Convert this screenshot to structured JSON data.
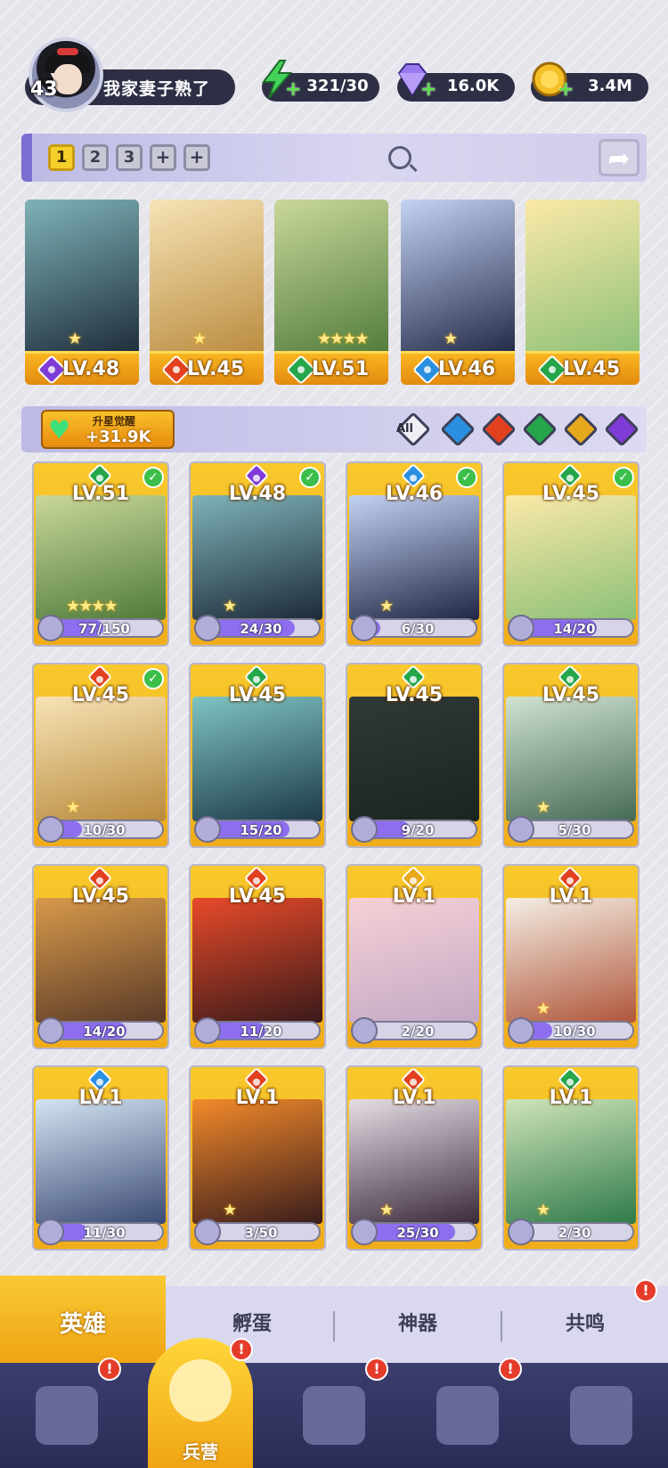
{
  "player": {
    "level": "43",
    "name": "我家妻子熟了"
  },
  "resources": [
    {
      "name": "energy",
      "icon": "lightning-icon",
      "value": "321/30",
      "color": "#43d35a"
    },
    {
      "name": "gems",
      "icon": "diamond-icon",
      "value": "16.0K",
      "color": "#9a7af0"
    },
    {
      "name": "gold",
      "icon": "coin-icon",
      "value": "3.4M",
      "color": "#f5c026"
    }
  ],
  "team": {
    "tabs": [
      "1",
      "2",
      "3",
      "+",
      "+"
    ],
    "active_tab": "1",
    "slots": [
      {
        "level": "LV.48",
        "element": "purple",
        "stars": "★"
      },
      {
        "level": "LV.45",
        "element": "fire",
        "stars": "★"
      },
      {
        "level": "LV.51",
        "element": "nature",
        "stars": "★★★★"
      },
      {
        "level": "LV.46",
        "element": "water",
        "stars": "★"
      },
      {
        "level": "LV.45",
        "element": "nature",
        "stars": ""
      }
    ]
  },
  "filter": {
    "awaken_label": "升星觉醒",
    "awaken_value": "+31.9K",
    "all_label": "All",
    "elements": [
      "water",
      "fire",
      "nature",
      "light",
      "purple"
    ]
  },
  "heroes": [
    {
      "level": "LV.51",
      "element": "nature",
      "checked": true,
      "shards": "77/150",
      "fill": 0.51,
      "stars": "★★★★",
      "art": [
        "#c9d89a",
        "#4f7a3a"
      ]
    },
    {
      "level": "LV.48",
      "element": "purple",
      "checked": true,
      "shards": "24/30",
      "fill": 0.8,
      "stars": "★",
      "art": [
        "#7fb3b8",
        "#1d2a38"
      ]
    },
    {
      "level": "LV.46",
      "element": "water",
      "checked": true,
      "shards": "6/30",
      "fill": 0.2,
      "stars": "★",
      "art": [
        "#c3d3f3",
        "#202645"
      ]
    },
    {
      "level": "LV.45",
      "element": "nature",
      "checked": true,
      "shards": "14/20",
      "fill": 0.7,
      "stars": "",
      "art": [
        "#fbe9a8",
        "#8cc077"
      ]
    },
    {
      "level": "LV.45",
      "element": "fire",
      "checked": true,
      "shards": "10/30",
      "fill": 0.33,
      "stars": "★",
      "art": [
        "#f6e3b6",
        "#b98a3d"
      ]
    },
    {
      "level": "LV.45",
      "element": "nature",
      "checked": false,
      "shards": "15/20",
      "fill": 0.75,
      "stars": "",
      "art": [
        "#7fc4c2",
        "#1d3a48"
      ]
    },
    {
      "level": "LV.45",
      "element": "nature",
      "checked": false,
      "shards": "9/20",
      "fill": 0.45,
      "stars": "",
      "art": [
        "#2f3a38",
        "#1a2420"
      ]
    },
    {
      "level": "LV.45",
      "element": "nature",
      "checked": false,
      "shards": "5/30",
      "fill": 0.17,
      "stars": "★",
      "art": [
        "#cfe3d1",
        "#466a56"
      ]
    },
    {
      "level": "LV.45",
      "element": "fire",
      "checked": false,
      "shards": "14/20",
      "fill": 0.7,
      "stars": "",
      "art": [
        "#d89a4b",
        "#5a3a28"
      ]
    },
    {
      "level": "LV.45",
      "element": "fire",
      "checked": false,
      "shards": "11/20",
      "fill": 0.55,
      "stars": "",
      "art": [
        "#e84a2a",
        "#3a1a1a"
      ]
    },
    {
      "level": "LV.1",
      "element": "light",
      "checked": false,
      "shards": "2/20",
      "fill": 0.1,
      "stars": "",
      "art": [
        "#f6d0d6",
        "#c3a9c5"
      ]
    },
    {
      "level": "LV.1",
      "element": "fire",
      "checked": false,
      "shards": "10/30",
      "fill": 0.33,
      "stars": "★",
      "art": [
        "#f4eee4",
        "#b0563b"
      ]
    },
    {
      "level": "LV.1",
      "element": "water",
      "checked": false,
      "shards": "11/30",
      "fill": 0.37,
      "stars": "",
      "art": [
        "#d3e4f3",
        "#3b4a73"
      ]
    },
    {
      "level": "LV.1",
      "element": "fire",
      "checked": false,
      "shards": "3/50",
      "fill": 0.06,
      "stars": "★",
      "art": [
        "#f38a2a",
        "#3a1c1c"
      ]
    },
    {
      "level": "LV.1",
      "element": "fire",
      "checked": false,
      "shards": "25/30",
      "fill": 0.83,
      "stars": "★",
      "art": [
        "#e5dde6",
        "#3a2a3a"
      ]
    },
    {
      "level": "LV.1",
      "element": "nature",
      "checked": false,
      "shards": "2/30",
      "fill": 0.07,
      "stars": "★",
      "art": [
        "#cfe4b9",
        "#2e7a4a"
      ]
    }
  ],
  "sub_tabs": [
    {
      "label": "英雄",
      "active": true,
      "badge": false
    },
    {
      "label": "孵蛋",
      "active": false,
      "badge": false
    },
    {
      "label": "神器",
      "active": false,
      "badge": false
    },
    {
      "label": "共鸣",
      "active": false,
      "badge": true
    }
  ],
  "bottom_nav": [
    {
      "label": "",
      "icon": "cards-icon",
      "badge": true
    },
    {
      "label": "兵营",
      "icon": "barracks-icon",
      "badge": true,
      "active": true
    },
    {
      "label": "",
      "icon": "map-icon",
      "badge": true
    },
    {
      "label": "",
      "icon": "temple-icon",
      "badge": true
    },
    {
      "label": "",
      "icon": "guild-icon",
      "badge": false
    }
  ],
  "badge_symbol": "!",
  "element_colors": {
    "purple": "#7f3bd6",
    "fire": "#e2401f",
    "nature": "#25a64a",
    "water": "#2a8fe0",
    "light": "#e6a81c"
  }
}
